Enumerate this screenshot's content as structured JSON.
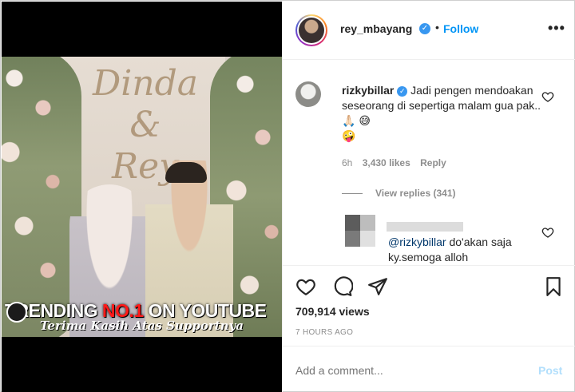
{
  "media": {
    "sign_text_line1": "Dinda",
    "sign_text_amp": "&",
    "sign_text_line2": "Rey",
    "banner_prefix": "TRENDING ",
    "banner_highlight": "NO.1",
    "banner_suffix": " ON YOUTUBE",
    "banner_subtitle": "Terima Kasih Atas Supportnya"
  },
  "header": {
    "username": "rey_mbayang",
    "separator": "•",
    "follow_label": "Follow",
    "more_label": "•••"
  },
  "comment": {
    "username": "rizkybillar",
    "text": " Jadi pengen mendoakan seseorang di sepertiga malam gua pak.. ",
    "emoji_1": "🙏🏻",
    "emoji_2": "😅",
    "emoji_3": "🤪",
    "time": "6h",
    "likes": "3,430 likes",
    "reply_label": "Reply",
    "view_replies": "View replies (341)"
  },
  "reply": {
    "mention": "@rizkybillar",
    "text": " do'akan saja ky.semoga alloh"
  },
  "actions": {
    "like_icon": "heart-icon",
    "comment_icon": "comment-icon",
    "share_icon": "share-icon",
    "save_icon": "bookmark-icon",
    "views": "709,914 views",
    "posted": "7 HOURS AGO"
  },
  "composer": {
    "placeholder": "Add a comment...",
    "post_label": "Post"
  },
  "colors": {
    "accent": "#0095f6",
    "verified": "#3897f0",
    "post_disabled": "#b2dffc",
    "banner_highlight": "#ff1a1a"
  }
}
